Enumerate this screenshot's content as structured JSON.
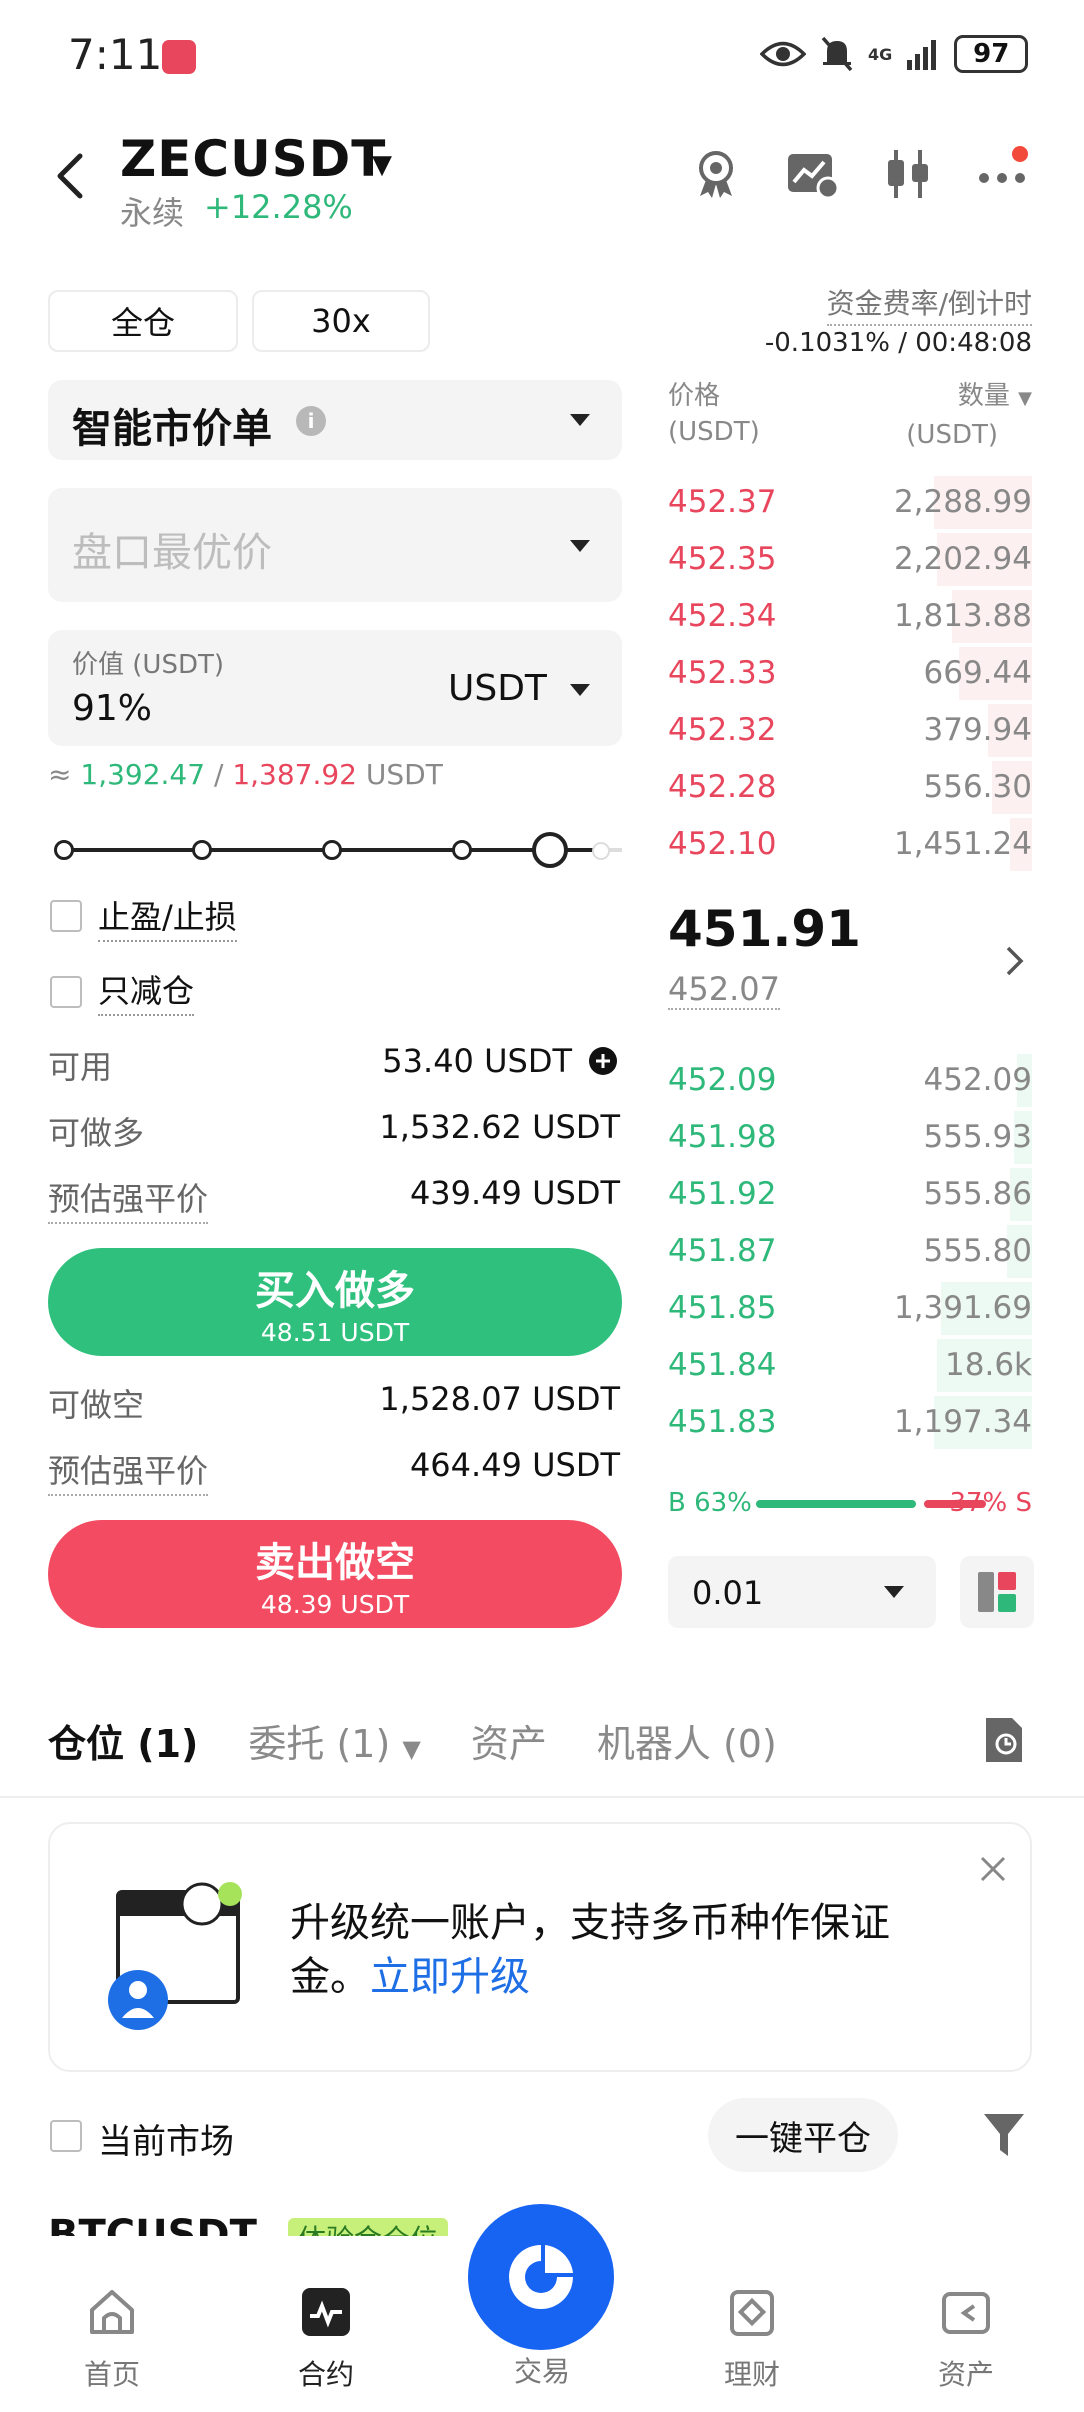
{
  "status_bar": {
    "time": "7:11",
    "network": "4G",
    "battery": "97"
  },
  "header": {
    "pair": "ZECUSDT",
    "contract_type": "永续",
    "change": "+12.28%"
  },
  "margin": {
    "mode": "全仓",
    "leverage": "30x"
  },
  "funding": {
    "label": "资金费率/倒计时",
    "value": "-0.1031% / 00:48:08"
  },
  "order_form": {
    "order_type": "智能市价单",
    "price_placeholder": "盘口最优价",
    "value_label": "价值 (USDT)",
    "value_input": "91%",
    "value_unit": "USDT",
    "approx_prefix": "≈",
    "approx_long": "1,392.47",
    "approx_sep": "/",
    "approx_short": "1,387.92",
    "approx_unit": "USDT",
    "slider_percent": 91,
    "tp_sl_label": "止盈/止损",
    "reduce_only_label": "只减仓"
  },
  "account": {
    "available_label": "可用",
    "available_value": "53.40 USDT",
    "max_long_label": "可做多",
    "max_long_value": "1,532.62 USDT",
    "liq_long_label": "预估强平价",
    "liq_long_value": "439.49 USDT",
    "max_short_label": "可做空",
    "max_short_value": "1,528.07 USDT",
    "liq_short_label": "预估强平价",
    "liq_short_value": "464.49 USDT"
  },
  "buttons": {
    "buy_label": "买入做多",
    "buy_sub": "48.51 USDT",
    "sell_label": "卖出做空",
    "sell_sub": "48.39 USDT"
  },
  "orderbook": {
    "price_header": "价格",
    "price_unit": "(USDT)",
    "qty_header": "数量",
    "qty_unit": "(USDT)",
    "asks": [
      {
        "price": "452.37",
        "qty": "2,288.99",
        "depth": 0.27
      },
      {
        "price": "452.35",
        "qty": "2,202.94",
        "depth": 0.26
      },
      {
        "price": "452.34",
        "qty": "1,813.88",
        "depth": 0.22
      },
      {
        "price": "452.33",
        "qty": "669.44",
        "depth": 0.2
      },
      {
        "price": "452.32",
        "qty": "379.94",
        "depth": 0.12
      },
      {
        "price": "452.28",
        "qty": "556.30",
        "depth": 0.11
      },
      {
        "price": "452.10",
        "qty": "1,451.24",
        "depth": 0.06
      }
    ],
    "mid_price": "451.91",
    "mark_price": "452.07",
    "bids": [
      {
        "price": "452.09",
        "qty": "452.09",
        "depth": 0.04
      },
      {
        "price": "451.98",
        "qty": "555.93",
        "depth": 0.05
      },
      {
        "price": "451.92",
        "qty": "555.86",
        "depth": 0.06
      },
      {
        "price": "451.87",
        "qty": "555.80",
        "depth": 0.07
      },
      {
        "price": "451.85",
        "qty": "1,391.69",
        "depth": 0.25
      },
      {
        "price": "451.84",
        "qty": "18.6k",
        "depth": 0.26
      },
      {
        "price": "451.83",
        "qty": "1,197.34",
        "depth": 0.27
      }
    ],
    "buy_ratio": "B 63%",
    "sell_ratio": "37% S",
    "precision": "0.01"
  },
  "tabs": [
    {
      "label": "仓位 (1)"
    },
    {
      "label": "委托 (1)"
    },
    {
      "label": "资产"
    },
    {
      "label": "机器人 (0)"
    }
  ],
  "upgrade_card": {
    "text": "升级统一账户，支持多币种作保证金。",
    "link": "立即升级"
  },
  "positions": {
    "current_market_label": "当前市场",
    "close_all_label": "一键平仓",
    "next_symbol": "BTCUSDT",
    "next_badge": "体验金仓位"
  },
  "bottom_nav": [
    {
      "label": "首页"
    },
    {
      "label": "合约"
    },
    {
      "label": "交易"
    },
    {
      "label": "理财"
    },
    {
      "label": "资产"
    }
  ]
}
